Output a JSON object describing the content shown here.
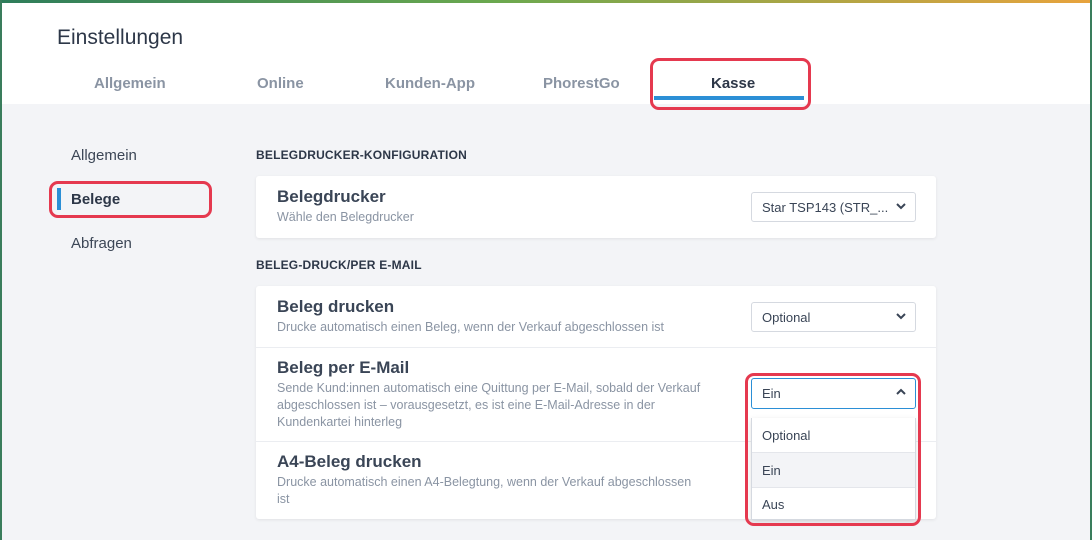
{
  "page_title": "Einstellungen",
  "tabs": [
    {
      "label": "Allgemein"
    },
    {
      "label": "Online"
    },
    {
      "label": "Kunden-App"
    },
    {
      "label": "PhorestGo"
    },
    {
      "label": "Kasse"
    }
  ],
  "active_tab": "Kasse",
  "sidebar": {
    "items": [
      {
        "label": "Allgemein"
      },
      {
        "label": "Belege"
      },
      {
        "label": "Abfragen"
      }
    ],
    "active": "Belege"
  },
  "sections": {
    "printer": {
      "title": "BELEGDRUCKER-KONFIGURATION",
      "rows": [
        {
          "title": "Belegdrucker",
          "desc": "Wähle den Belegdrucker",
          "value": "Star TSP143 (STR_..."
        }
      ]
    },
    "print_email": {
      "title": "BELEG-DRUCK/PER E-MAIL",
      "rows": [
        {
          "title": "Beleg drucken",
          "desc": "Drucke automatisch einen Beleg, wenn der Verkauf abgeschlossen ist",
          "value": "Optional"
        },
        {
          "title": "Beleg per E-Mail",
          "desc_lines": [
            "Sende Kund:innen automatisch eine Quittung per E-Mail, sobald der Verkauf",
            "abgeschlossen ist – vorausgesetzt, es ist eine E-Mail-Adresse in der",
            "Kundenkartei hinterleg"
          ],
          "value": "Ein"
        },
        {
          "title": "A4-Beleg drucken",
          "desc_lines": [
            "Drucke automatisch einen A4-Belegtung, wenn der Verkauf abgeschlossen",
            "ist"
          ]
        }
      ]
    }
  },
  "dropdown_options": [
    "Optional",
    "Ein",
    "Aus"
  ],
  "dropdown_highlighted": "Ein",
  "icons": {
    "chevron_down": "chevron-down-icon",
    "chevron_up": "chevron-up-icon"
  },
  "colors": {
    "accent": "#2b8fd6",
    "highlight": "#e5394f"
  }
}
